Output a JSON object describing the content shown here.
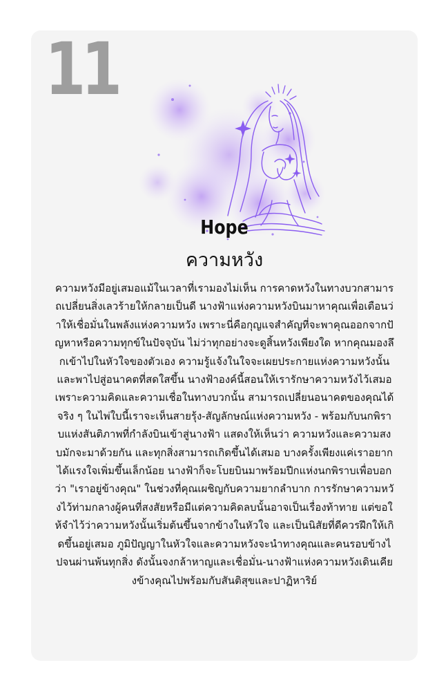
{
  "card": {
    "number": "11",
    "title_en": "Hope",
    "title_th": "ความหวัง",
    "illustration_icon": "kneeling-angel-icon",
    "accent_color": "#8a5cf0",
    "glow_color": "#c9aef7",
    "description": "ความหวังมีอยู่เสมอแม้ในเวลาที่เรามองไม่เห็น การคาดหวังในทางบวกสามารถเปลี่ยนสิ่งเลวร้ายให้กลายเป็นดี นางฟ้าแห่งความหวังบินมาหาคุณเพื่อเตือนว่าให้เชื่อมั่นในพลังแห่งความหวัง เพราะนี่คือกุญแจสำคัญที่จะพาคุณออกจากปัญหาหรือความทุกข์ในปัจจุบัน ไม่ว่าทุกอย่างจะดูสิ้นหวังเพียงใด หากคุณมองลึกเข้าไปในหัวใจของตัวเอง ความรู้แจ้งในใจจะเผยประกายแห่งความหวังนั้น และพาไปสู่อนาคตที่สดใสขึ้น นางฟ้าองค์นี้สอนให้เรารักษาความหวังไว้เสมอ เพราะความคิดและความเชื่อในทางบวกนั้น สามารถเปลี่ยนอนาคตของคุณได้จริง ๆ ในไพ่ใบนี้เราจะเห็นสายรุ้ง-สัญลักษณ์แห่งความหวัง - พร้อมกับนกพิราบแห่งสันติภาพที่กำลังบินเข้าสู่นางฟ้า แสดงให้เห็นว่า ความหวังและความสงบมักจะมาด้วยกัน และทุกสิ่งสามารถเกิดขึ้นได้เสมอ บางครั้งเพียงแค่เราอยากได้แรงใจเพิ่มขึ้นเล็กน้อย นางฟ้าก็จะโบยบินมาพร้อมปีกแห่งนกพิราบเพื่อบอกว่า \"เราอยู่ข้างคุณ\" ในช่วงที่คุณเผชิญกับความยากลำบาก การรักษาความหวังไว้ท่ามกลางผู้คนที่สงสัยหรือมีแต่ความคิดลบนั้นอาจเป็นเรื่องท้าทาย แต่ขอให้จำไว้ว่าความหวังนั้นเริ่มต้นขึ้นจากข้างในหัวใจ และเป็นนิสัยที่ดีควรฝึกให้เกิดขึ้นอยู่เสมอ ภูมิปัญญาในหัวใจและความหวังจะนำทางคุณและคนรอบข้างไปจนผ่านพ้นทุกสิ่ง ดังนั้นจงกล้าหาญและเชื่อมั่น-นางฟ้าแห่งความหวังเดินเคียงข้างคุณไปพร้อมกับสันติสุขและปาฏิหาริย์"
  }
}
